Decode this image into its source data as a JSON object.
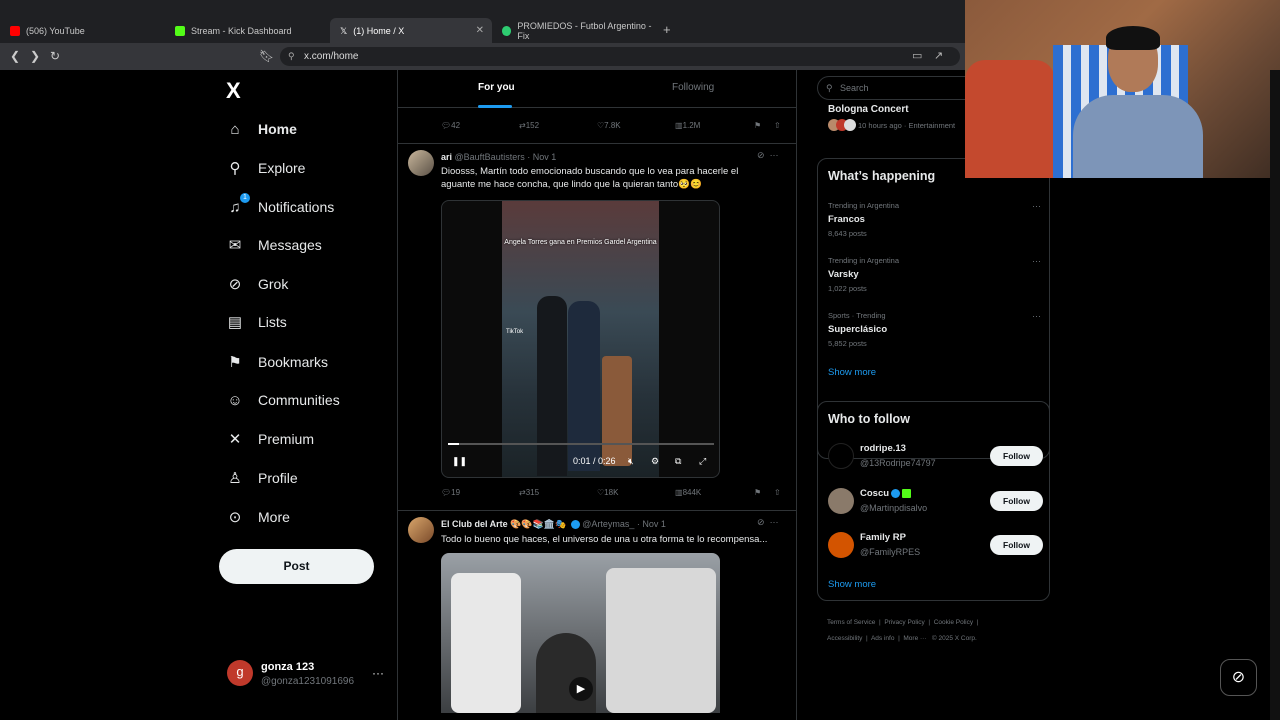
{
  "browser": {
    "tabs": [
      {
        "label": "(506) YouTube",
        "color": "#ff0000"
      },
      {
        "label": "Stream - Kick Dashboard",
        "color": "#53fc18"
      },
      {
        "label": "(1) Home / X",
        "color": "#ffffff"
      },
      {
        "label": "PROMIEDOS - Futbol Argentino - Fix",
        "color": "#2ecc71"
      }
    ],
    "url": "x.com/home"
  },
  "leftnav": {
    "logo": "X",
    "items": [
      {
        "label": "Home",
        "icon": "home-icon"
      },
      {
        "label": "Explore",
        "icon": "search-icon"
      },
      {
        "label": "Notifications",
        "icon": "bell-icon",
        "badge": "1"
      },
      {
        "label": "Messages",
        "icon": "envelope-icon"
      },
      {
        "label": "Grok",
        "icon": "grok-icon"
      },
      {
        "label": "Lists",
        "icon": "list-icon"
      },
      {
        "label": "Bookmarks",
        "icon": "bookmark-icon"
      },
      {
        "label": "Communities",
        "icon": "people-icon"
      },
      {
        "label": "Premium",
        "icon": "x-icon"
      },
      {
        "label": "Profile",
        "icon": "person-icon"
      },
      {
        "label": "More",
        "icon": "more-circle-icon"
      }
    ],
    "post_label": "Post",
    "account": {
      "initial": "g",
      "name": "gonza 123",
      "handle": "@gonza1231091696"
    }
  },
  "feed": {
    "tabs": [
      "For you",
      "Following"
    ],
    "prev_actions": {
      "replies": "42",
      "reposts": "152",
      "likes": "7.8K",
      "views": "1.2M"
    },
    "tweet1": {
      "name": "ari",
      "handle": "@BauftBautisters",
      "date": "· Nov 1",
      "text": "Dioosss, Martín todo emocionado buscando que lo vea para hacerle el aguante me hace concha, que lindo que la quieran tanto🥺😊",
      "video_caption": "Angela Torres gana en Premios Gardel Argentina",
      "video_time": "0:01 / 0:26",
      "tiktok_label": "TikTok",
      "progress": 0.04,
      "actions": {
        "replies": "19",
        "reposts": "315",
        "likes": "18K",
        "views": "844K"
      }
    },
    "tweet2": {
      "name": "El Club del Arte 🎨🎨📚🏛️🎭",
      "handle": "@Arteymas_",
      "date": "· Nov 1",
      "text": "Todo lo bueno que haces, el universo de una u otra forma te lo recompensa..."
    }
  },
  "sidebar": {
    "search_placeholder": "Search",
    "top_trend": {
      "title": "Bologna Concert",
      "meta": "10 hours ago · Entertainment"
    },
    "happening_title": "What’s happening",
    "trends": [
      {
        "category": "Trending in Argentina",
        "name": "Francos",
        "count": "8,643 posts"
      },
      {
        "category": "Trending in Argentina",
        "name": "Varsky",
        "count": "1,022 posts"
      },
      {
        "category": "Sports · Trending",
        "name": "Superclásico",
        "count": "5,852 posts"
      }
    ],
    "show_more": "Show more",
    "wtf_title": "Who to follow",
    "follow_label": "Follow",
    "who_to_follow": [
      {
        "name": "rodripe.13",
        "handle": "@13Rodripe74797",
        "avatar_color": "#000000"
      },
      {
        "name": "Coscu",
        "handle": "@Martinpdisalvo",
        "avatar_color": "#8a7a6a"
      },
      {
        "name": "Family RP",
        "handle": "@FamilyRPES",
        "avatar_color": "#d35400"
      }
    ],
    "footer": [
      "Terms of Service",
      "Privacy Policy",
      "Cookie Policy",
      "Accessibility",
      "Ads info",
      "More ···",
      "© 2025 X Corp."
    ]
  }
}
